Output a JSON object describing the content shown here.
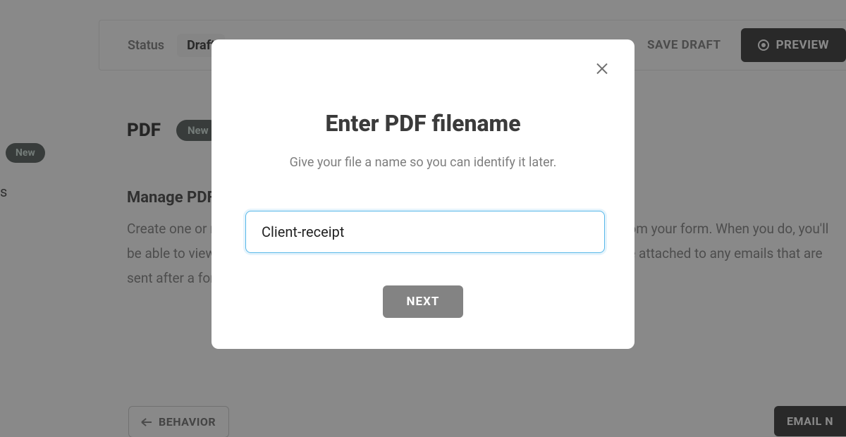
{
  "topbar": {
    "status_label": "Status",
    "status_value": "Draft",
    "save_draft_label": "SAVE DRAFT",
    "preview_label": "PREVIEW"
  },
  "sidebar": {
    "new_badge": "New",
    "trailing_s": "s"
  },
  "main": {
    "pdf_title": "PDF",
    "pdf_new_badge": "New",
    "manage_heading": "Manage PDFs",
    "manage_body": "Create one or more PDF templates that get populated with the responses gathered from your form. When you do, you'll be able to view and populated PDFs in the Form Responses section. PDF's will also be attached to any emails that are sent after a form submission."
  },
  "footer": {
    "behavior_label": "BEHAVIOR",
    "email_label": "EMAIL N"
  },
  "modal": {
    "title": "Enter PDF filename",
    "subtitle": "Give your file a name so you can identify it later.",
    "input_value": "Client-receipt",
    "next_label": "NEXT"
  }
}
